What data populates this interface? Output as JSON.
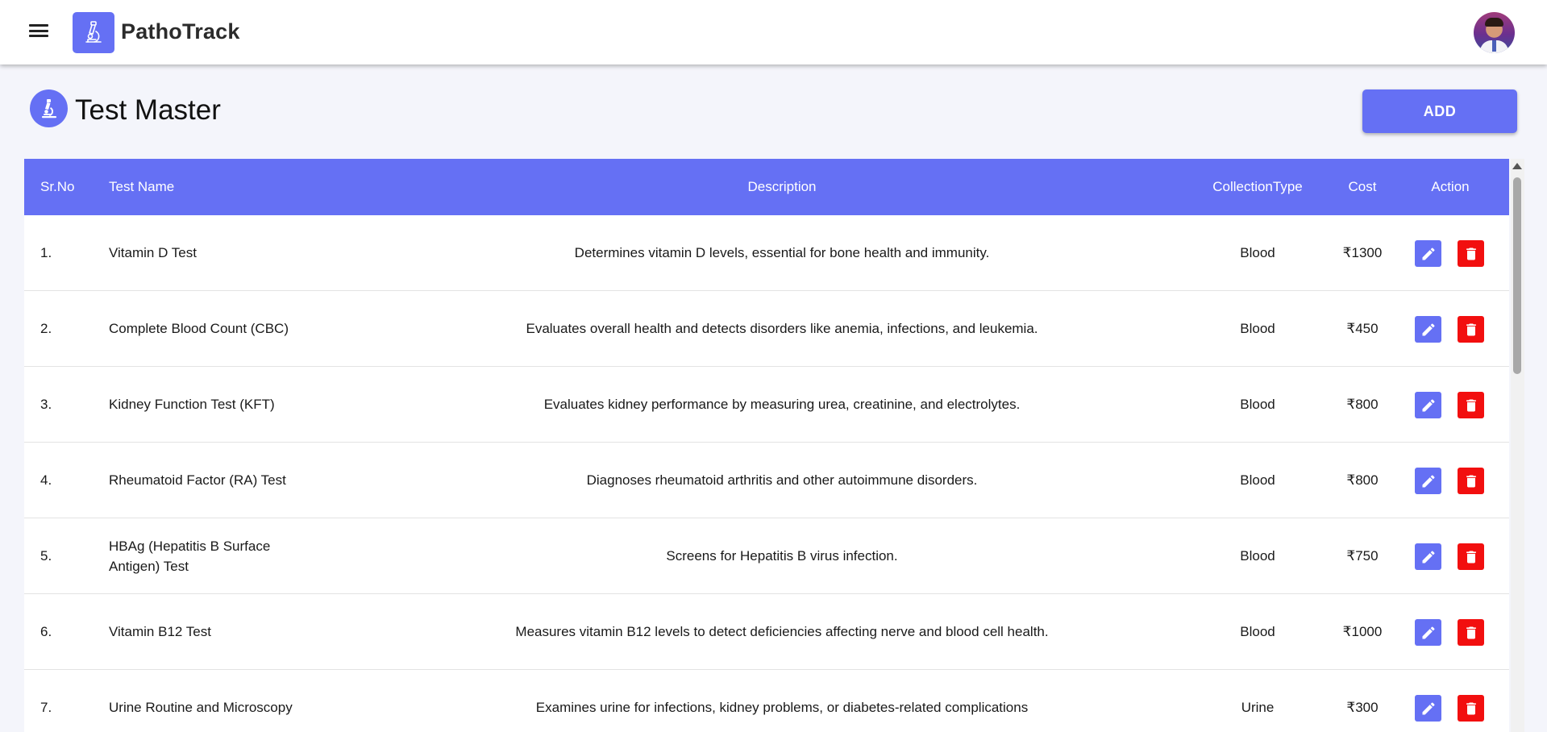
{
  "app": {
    "brand": "PathoTrack",
    "icons": {
      "menu": "menu-icon",
      "logo": "microscope-icon",
      "avatar": "user-avatar"
    }
  },
  "page": {
    "title": "Test Master",
    "add_label": "ADD",
    "accent_color": "#6570f4",
    "delete_color": "#f20f0f"
  },
  "table": {
    "columns": {
      "sr": "Sr.No",
      "name": "Test Name",
      "desc": "Description",
      "collection": "CollectionType",
      "cost": "Cost",
      "action": "Action"
    },
    "rows": [
      {
        "sr": "1.",
        "name": "Vitamin D Test",
        "desc": "Determines vitamin D levels, essential for bone health and immunity.",
        "collection": "Blood",
        "cost": "₹1300"
      },
      {
        "sr": "2.",
        "name": "Complete Blood Count (CBC)",
        "desc": "Evaluates overall health and detects disorders like anemia, infections, and leukemia.",
        "collection": "Blood",
        "cost": "₹450"
      },
      {
        "sr": "3.",
        "name": "Kidney Function Test (KFT)",
        "desc": "Evaluates kidney performance by measuring urea, creatinine, and electrolytes.",
        "collection": "Blood",
        "cost": "₹800"
      },
      {
        "sr": "4.",
        "name": "Rheumatoid Factor (RA) Test",
        "desc": "Diagnoses rheumatoid arthritis and other autoimmune disorders.",
        "collection": "Blood",
        "cost": "₹800"
      },
      {
        "sr": "5.",
        "name": "HBAg (Hepatitis B Surface Antigen) Test",
        "desc": "Screens for Hepatitis B virus infection.",
        "collection": "Blood",
        "cost": "₹750"
      },
      {
        "sr": "6.",
        "name": "Vitamin B12 Test",
        "desc": "Measures vitamin B12 levels to detect deficiencies affecting nerve and blood cell health.",
        "collection": "Blood",
        "cost": "₹1000"
      },
      {
        "sr": "7.",
        "name": "Urine Routine and Microscopy",
        "desc": "Examines urine for infections, kidney problems, or diabetes-related complications",
        "collection": "Urine",
        "cost": "₹300"
      }
    ],
    "row_icons": {
      "edit": "pencil-icon",
      "delete": "trash-icon"
    }
  }
}
